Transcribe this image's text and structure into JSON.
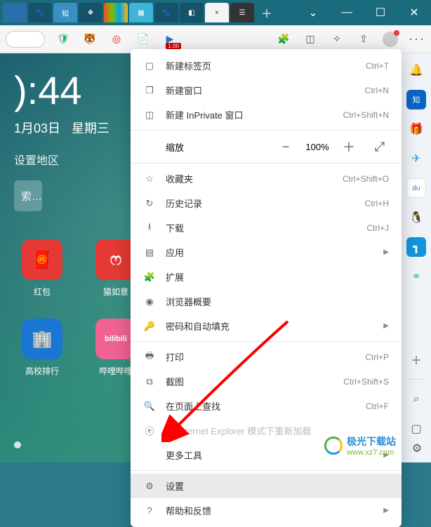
{
  "window": {
    "title_active": "×"
  },
  "tabs": {
    "add": "＋"
  },
  "toolbar": {
    "badge": "1.00",
    "menu_dots": "···"
  },
  "content": {
    "time": "):44",
    "date": "1月03日",
    "weekday": "星期三",
    "region": "设置地区",
    "search": "索…",
    "tiles": [
      {
        "label": "红包",
        "bg": "#e53935"
      },
      {
        "label": "猿如意",
        "bg": "#e53935"
      },
      {
        "label": "高校排行",
        "bg": "#1976d2"
      },
      {
        "label": "哔哩哔哩",
        "bg": "#f06292"
      }
    ]
  },
  "menu": {
    "new_tab": {
      "label": "新建标签页",
      "shortcut": "Ctrl+T"
    },
    "new_window": {
      "label": "新建窗口",
      "shortcut": "Ctrl+N"
    },
    "new_inprivate": {
      "label": "新建 InPrivate 窗口",
      "shortcut": "Ctrl+Shift+N"
    },
    "zoom": {
      "label": "缩放",
      "value": "100%"
    },
    "favorites": {
      "label": "收藏夹",
      "shortcut": "Ctrl+Shift+O"
    },
    "history": {
      "label": "历史记录",
      "shortcut": "Ctrl+H"
    },
    "downloads": {
      "label": "下载",
      "shortcut": "Ctrl+J"
    },
    "apps": {
      "label": "应用"
    },
    "extensions": {
      "label": "扩展"
    },
    "essentials": {
      "label": "浏览器概要"
    },
    "passwords": {
      "label": "密码和自动填充"
    },
    "print": {
      "label": "打印",
      "shortcut": "Ctrl+P"
    },
    "screenshot": {
      "label": "截图",
      "shortcut": "Ctrl+Shift+S"
    },
    "find": {
      "label": "在页面上查找",
      "shortcut": "Ctrl+F"
    },
    "ie_mode": {
      "label": "在 Internet Explorer 模式下重新加载"
    },
    "more_tools": {
      "label": "更多工具"
    },
    "settings": {
      "label": "设置"
    },
    "help": {
      "label": "帮助和反馈"
    }
  },
  "watermark": {
    "text1": "极光下载站",
    "text2": "www.xz7.com"
  }
}
